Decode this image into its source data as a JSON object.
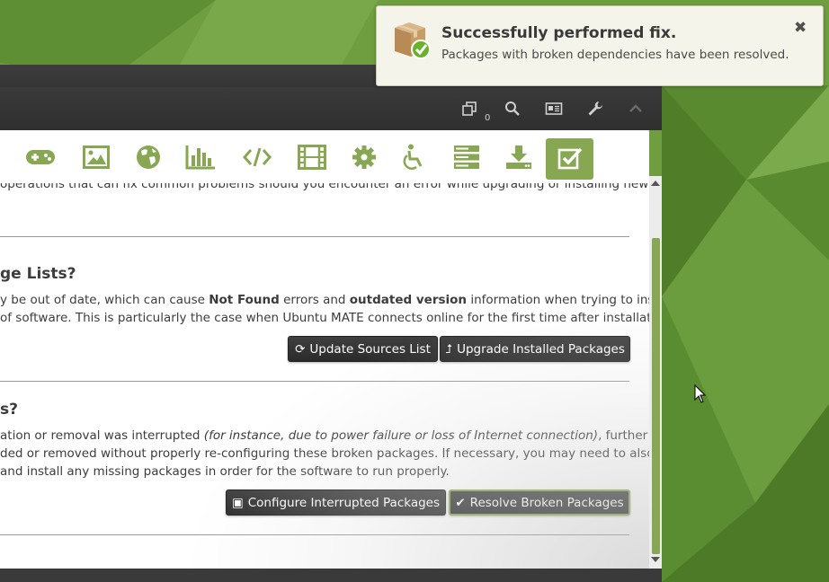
{
  "notification": {
    "title": "Successfully performed fix.",
    "body": "Packages with broken dependencies have been resolved.",
    "close_glyph": "✖",
    "icon": "package-installed-icon"
  },
  "headerbar": {
    "icons": [
      "windows-icon",
      "search-icon",
      "news-icon",
      "wrench-icon",
      "chevron-up-icon"
    ],
    "badge_count": "0"
  },
  "categories": {
    "icons": [
      "gamepad-icon",
      "image-icon",
      "globe-icon",
      "bar-chart-icon",
      "code-icon",
      "film-icon",
      "gear-icon",
      "accessibility-icon",
      "server-icon",
      "download-icon",
      "checkbox-icon"
    ],
    "active": "checkbox-icon"
  },
  "sections": {
    "intro_line": "operations that can fix common problems should you encounter an error while upgrading or installing new",
    "sources": {
      "heading": "ge Lists?",
      "line1_prefix": "y be out of date, which can cause ",
      "line1_bold1": "Not Found",
      "line1_mid": " errors and ",
      "line1_bold2": "outdated version",
      "line1_suffix": " information when trying to install",
      "line2": "of software. This is particularly the case when Ubuntu MATE connects online for the first time after installation.",
      "update_button": "Update Sources List",
      "upgrade_button": "Upgrade Installed Packages"
    },
    "broken": {
      "heading": "s?",
      "line1_prefix": "ation or removal was interrupted ",
      "line1_italic": "(for instance, due to power failure or loss of Internet connection)",
      "line1_suffix": ", further",
      "line2": "ded or removed without properly re-configuring these broken packages. If necessary, you may need to also",
      "line3": "and install any missing packages in order for the software to run properly.",
      "configure_button": "Configure Interrupted Packages",
      "resolve_button": "Resolve Broken Packages"
    }
  },
  "colors": {
    "accent": "#87a752",
    "desktop": "#6a9a3c",
    "button_bg": "#333333"
  }
}
